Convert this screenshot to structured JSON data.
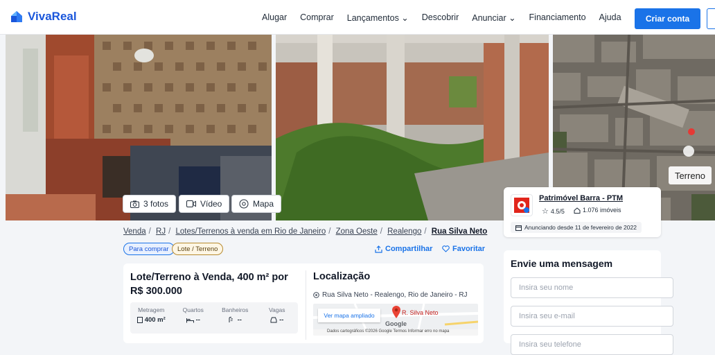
{
  "brand": {
    "name": "VivaReal",
    "color": "#1a56db"
  },
  "nav": {
    "items": [
      "Alugar",
      "Comprar",
      "Lançamentos ⌄",
      "Descobrir",
      "Anunciar ⌄",
      "Financiamento",
      "Ajuda"
    ],
    "create_account": "Criar conta"
  },
  "gallery": {
    "photos_chip": "3 fotos",
    "video_chip": "Vídeo",
    "map_chip": "Mapa",
    "terreno_label": "Terreno"
  },
  "breadcrumb": {
    "items": [
      "Venda",
      "RJ",
      "Lotes/Terrenos à venda em Rio de Janeiro",
      "Zona Oeste",
      "Realengo"
    ],
    "current": "Rua Silva Neto"
  },
  "tags": {
    "purpose": "Para comprar",
    "type": "Lote / Terreno"
  },
  "actions": {
    "share": "Compartilhar",
    "favorite": "Favoritar"
  },
  "listing": {
    "title": "Lote/Terreno à Venda, 400 m² por R$ 300.000",
    "stats": [
      {
        "label": "Metragem",
        "value": "400 m²",
        "icon": "area-icon"
      },
      {
        "label": "Quartos",
        "value": "--",
        "icon": "bed-icon"
      },
      {
        "label": "Banheiros",
        "value": "--",
        "icon": "shower-icon"
      },
      {
        "label": "Vagas",
        "value": "--",
        "icon": "car-icon"
      }
    ]
  },
  "location": {
    "title": "Localização",
    "address": "Rua Silva Neto - Realengo, Rio de Janeiro - RJ",
    "map_link": "Ver mapa ampliado",
    "map_pin_label": "R. Silva Neto",
    "map_footer": "Dados cartográficos ©2026 Google   Termos   Informar erro no mapa",
    "google": "Google"
  },
  "agent": {
    "name": "Patrimóvel Barra - PTM",
    "rating": "4.5/5",
    "properties": "1.076 imóveis",
    "since": "Anunciando desde 11 de fevereiro de 2022"
  },
  "contact_form": {
    "title": "Envie uma mensagem",
    "name_placeholder": "Insira seu nome",
    "email_placeholder": "Insira seu e-mail",
    "phone_placeholder": "Insira seu telefone"
  }
}
